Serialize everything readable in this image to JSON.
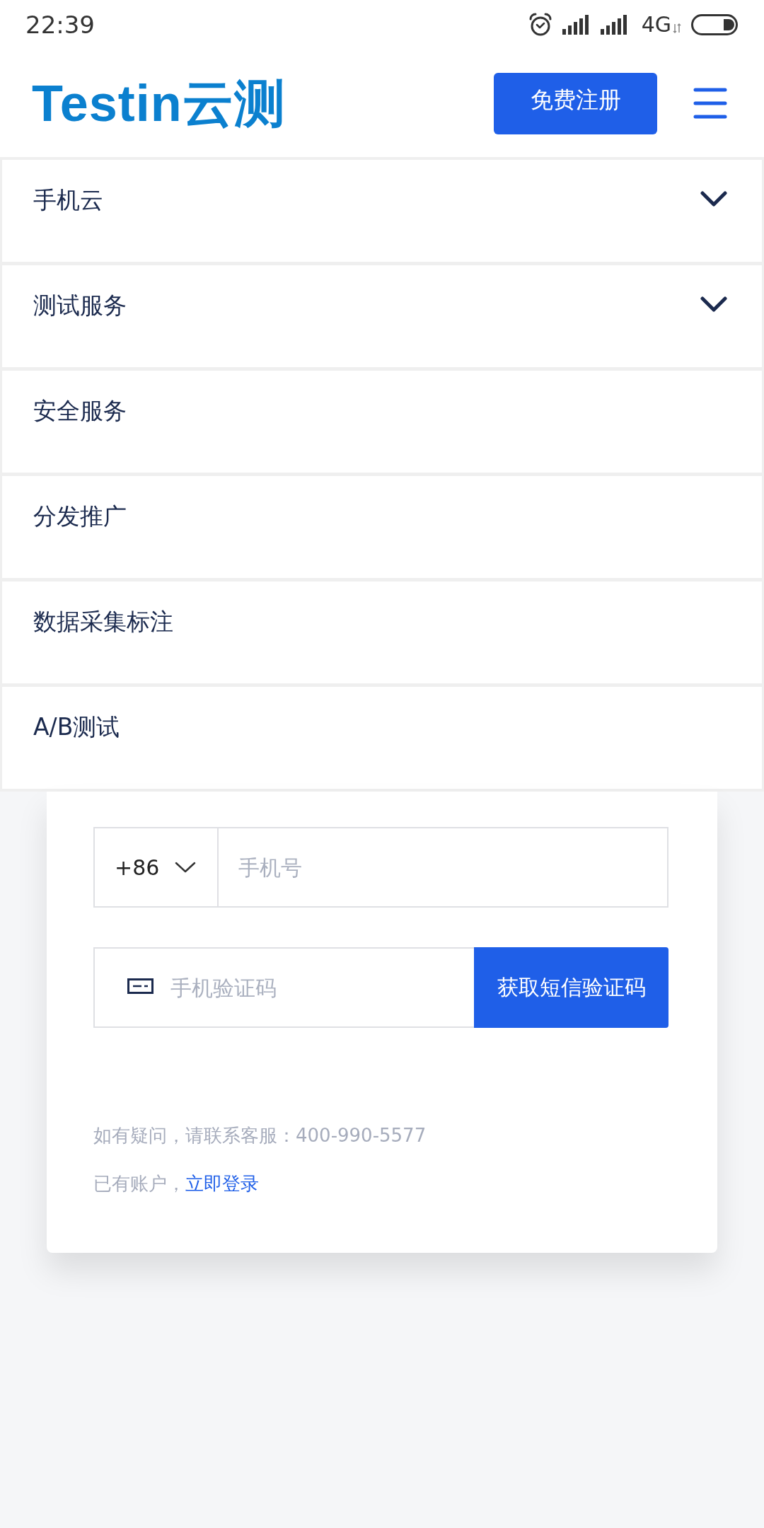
{
  "status_bar": {
    "time": "22:39",
    "network": "4G"
  },
  "header": {
    "logo": "Testin云测",
    "register_button": "免费注册"
  },
  "menu": {
    "items": [
      {
        "label": "手机云",
        "kind": "submenu"
      },
      {
        "label": "测试服务",
        "kind": "submenu"
      },
      {
        "label": "安全服务",
        "kind": "link"
      },
      {
        "label": "分发推广",
        "kind": "link"
      },
      {
        "label": "数据采集标注",
        "kind": "link"
      },
      {
        "label": "A/B测试",
        "kind": "link"
      }
    ]
  },
  "form": {
    "country_code": "+86",
    "phone": {
      "placeholder": "手机号"
    },
    "sms_code": {
      "placeholder": "手机验证码"
    },
    "sms_button": "获取短信验证码"
  },
  "help_text": "如有疑问，请联系客服：400-990-5577",
  "login_prompt": {
    "text": "已有账户，",
    "link": "立即登录"
  }
}
